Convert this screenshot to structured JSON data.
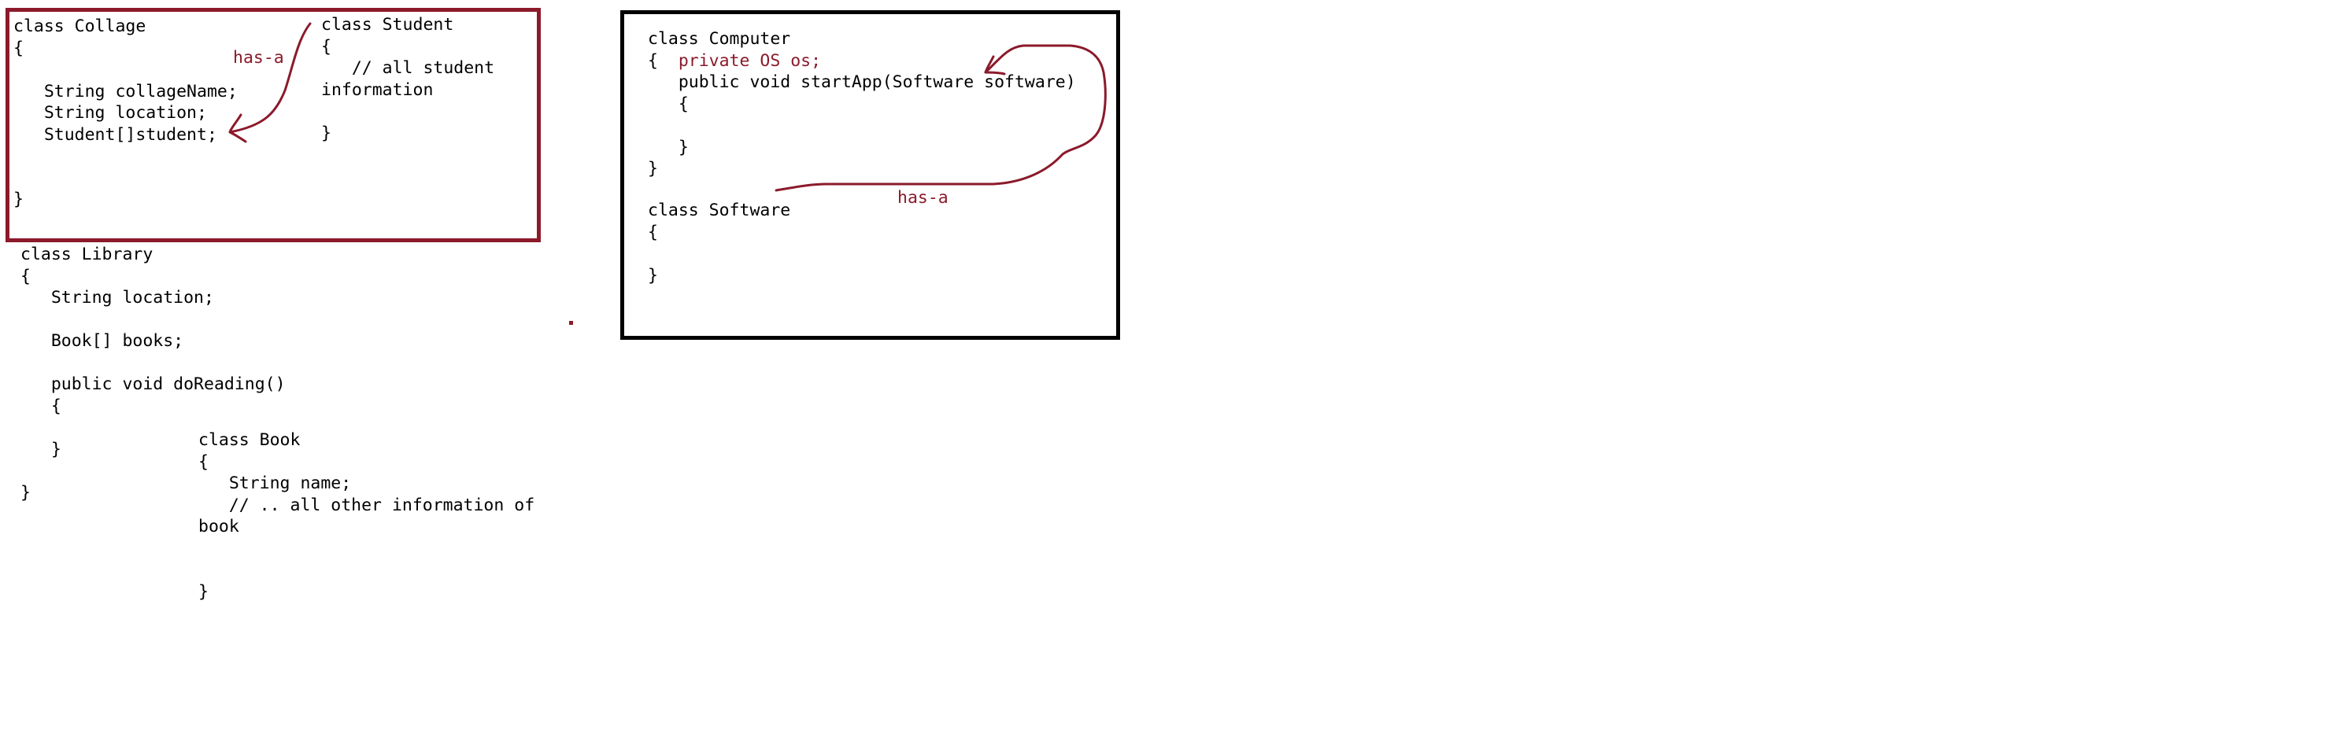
{
  "colors": {
    "ink": "#8b1a2b",
    "frame_collage": "#8b1a2b",
    "frame_computer": "#000000",
    "text": "#000000",
    "background": "#ffffff"
  },
  "collage": {
    "lines": [
      "class Collage",
      "{",
      "",
      "   String collageName;",
      "   String location;",
      "   Student[]student;",
      "",
      "",
      "}"
    ]
  },
  "student": {
    "lines": [
      "class Student",
      "{",
      "   // all student",
      "information",
      "",
      "}"
    ]
  },
  "has_a_left": "has-a",
  "library": {
    "lines": [
      "class Library",
      "{",
      "   String location;",
      "",
      "   Book[] books;",
      "",
      "   public void doReading()",
      "   {",
      "",
      "   }",
      "",
      "}"
    ]
  },
  "book": {
    "lines": [
      "class Book",
      "{",
      "   String name;",
      "   // .. all other information of",
      "book",
      "",
      "",
      "}"
    ]
  },
  "computer": {
    "open_line": "{",
    "field_line": "private OS os;",
    "lines": [
      "class Computer",
      "",
      "   public void startApp(Software software)",
      "   {",
      "",
      "   }",
      "}"
    ]
  },
  "software": {
    "lines": [
      "class Software",
      "{",
      "",
      "}"
    ]
  },
  "has_a_right": "has-a"
}
